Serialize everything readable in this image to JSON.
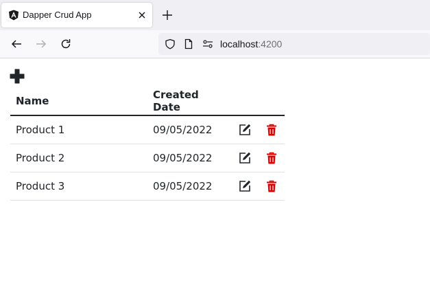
{
  "browser": {
    "tab": {
      "title": "Dapper Crud App",
      "favicon": "angular-icon"
    },
    "url": {
      "host": "localhost",
      "port": ":4200"
    }
  },
  "app": {
    "add_icon": "plus-icon",
    "table": {
      "headers": {
        "name": "Name",
        "created_date": "Created Date"
      },
      "rows": [
        {
          "name": "Product 1",
          "created_date": "09/05/2022"
        },
        {
          "name": "Product 2",
          "created_date": "09/05/2022"
        },
        {
          "name": "Product 3",
          "created_date": "09/05/2022"
        }
      ],
      "edit_icon": "edit-icon",
      "delete_icon": "trash-icon"
    }
  },
  "colors": {
    "delete": "#e00000",
    "text": "#212529",
    "favicon": "#1a1a1a"
  }
}
